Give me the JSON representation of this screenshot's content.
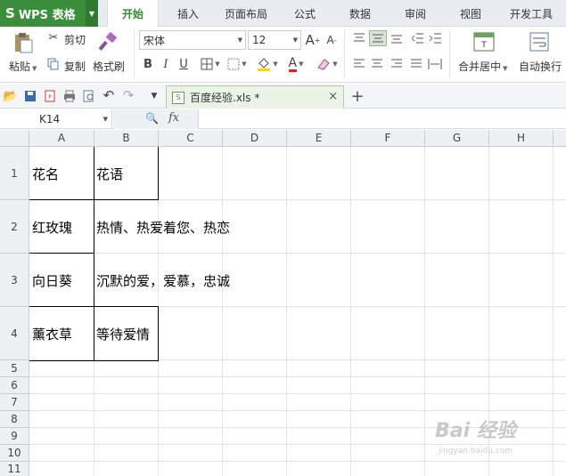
{
  "app": {
    "name": "WPS 表格",
    "logo_letter": "S"
  },
  "menu": {
    "tabs": [
      "开始",
      "插入",
      "页面布局",
      "公式",
      "数据",
      "审阅",
      "视图",
      "开发工具"
    ],
    "active": "开始"
  },
  "ribbon": {
    "paste_label": "粘贴",
    "cut_label": "剪切",
    "copy_label": "复制",
    "format_painter_label": "格式刷",
    "font_name": "宋体",
    "font_size": "12",
    "bold": "B",
    "italic": "I",
    "underline": "U",
    "font_color_glyph": "A",
    "grow_font": "A",
    "shrink_font": "A",
    "merge_center_label": "合并居中",
    "wrap_text_label": "自动换行"
  },
  "document": {
    "tab_title": "百度经验.xls *"
  },
  "formula_bar": {
    "cell_ref": "K14",
    "fx_label": "fx",
    "content": ""
  },
  "grid": {
    "columns": [
      "A",
      "B",
      "C",
      "D",
      "E",
      "F",
      "G",
      "H"
    ],
    "rows": [
      "1",
      "2",
      "3",
      "4",
      "5",
      "6",
      "7",
      "8",
      "9",
      "10",
      "11"
    ],
    "cells": {
      "A1": "花名",
      "B1": "花语",
      "A2": "红玫瑰",
      "B2": "热情、热爱着您、热恋",
      "A3": "向日葵",
      "B3": "沉默的爱，爱慕，忠诚",
      "A4": "薰衣草",
      "B4": "等待爱情"
    }
  },
  "watermark": {
    "text": "Bai 经验",
    "url": "jingyan.baidu.com"
  },
  "colors": {
    "accent_green": "#3b8e3b",
    "active_tab_text": "#2e8b2e"
  }
}
